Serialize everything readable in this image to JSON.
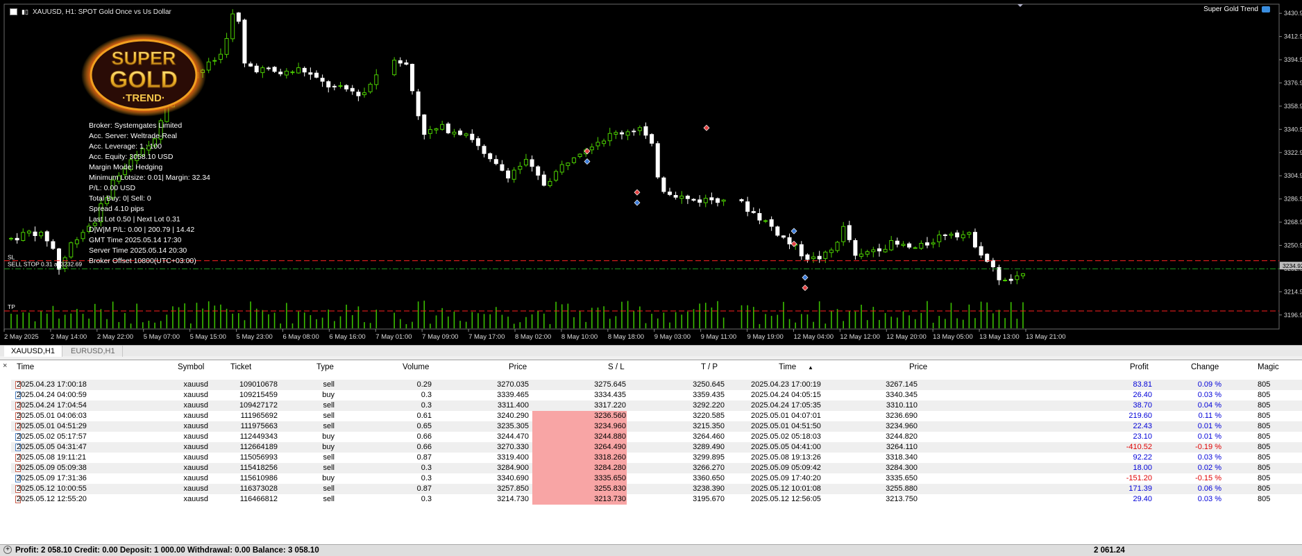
{
  "chart": {
    "title": "XAUUSD, H1:  SPOT Gold Once vs Us Dollar",
    "ea_name": "Super Gold Trend",
    "logo": {
      "line1": "SUPER",
      "line2": "GOLD",
      "line3": "·TREND·"
    },
    "info_lines": [
      "Broker:  Systemgates Limited",
      "Acc. Server:  Weltrade-Real",
      "Acc. Leverage:   1 : 100",
      "Acc. Equity:  3058.10 USD",
      "Margin Mode:  Hedging",
      "Minimum Lotsize: 0.01| Margin: 32.34",
      "P/L: 0.00 USD",
      "Total Buy: 0| Sell: 0",
      "Spread 4.10 pips",
      "Last Lot 0.50 | Next Lot 0.31",
      "D|W|M P/L: 0.00 | 200.79 | 14.42",
      "GMT Time 2025.05.14 17:30",
      "Server Time 2025.05.14 20:30",
      "Broker Offset 10800(UTC+03:00)"
    ],
    "sl_label": "SL",
    "sell_stop_label": "SELL STOP 0.31 at 3232.69",
    "tp_label": "TP",
    "current_price": "3234.92",
    "price_labels": [
      "3430.90",
      "3412.90",
      "3394.90",
      "3376.90",
      "3358.90",
      "3340.90",
      "3322.90",
      "3304.90",
      "3286.90",
      "3268.90",
      "3250.90",
      "3232.90",
      "3214.90",
      "3196.90"
    ],
    "time_labels": [
      "2 May 2025",
      "2 May 14:00",
      "2 May 22:00",
      "5 May 07:00",
      "5 May 15:00",
      "5 May 23:00",
      "6 May 08:00",
      "6 May 16:00",
      "7 May 01:00",
      "7 May 09:00",
      "7 May 17:00",
      "8 May 02:00",
      "8 May 10:00",
      "8 May 18:00",
      "9 May 03:00",
      "9 May 11:00",
      "9 May 19:00",
      "12 May 04:00",
      "12 May 12:00",
      "12 May 20:00",
      "13 May 05:00",
      "13 May 13:00",
      "13 May 21:00"
    ],
    "colors": {
      "background": "#000000",
      "bull_candle": "#4cd000",
      "bear_candle": "#ffffff",
      "volume": "#3bbf00",
      "sl_line": "#ff2020",
      "tp_line": "#ff2020",
      "stop_line": "#20a020"
    },
    "price_range": [
      3186,
      3438
    ]
  },
  "chart_tabs": [
    "XAUUSD,H1",
    "EURUSD,H1"
  ],
  "terminal": {
    "close_icon": "×",
    "columns": [
      "Time",
      "Symbol",
      "Ticket",
      "Type",
      "Volume",
      "Price",
      "S / L",
      "T / P",
      "Time",
      "Price",
      "Profit",
      "Change",
      "Magic"
    ],
    "sort_indicator": "▲",
    "rows": [
      {
        "open_time": "2025.04.23 17:00:18",
        "symbol": "xauusd",
        "ticket": "109010678",
        "type": "sell",
        "volume": "0.29",
        "price": "3270.035",
        "sl": "3275.645",
        "tp": "3250.645",
        "close_time": "2025.04.23 17:00:19",
        "close_price": "3267.145",
        "profit": "83.81",
        "change": "0.09 %",
        "magic": "805",
        "sl_hit": false,
        "loss": false
      },
      {
        "open_time": "2025.04.24 04:00:59",
        "symbol": "xauusd",
        "ticket": "109215459",
        "type": "buy",
        "volume": "0.3",
        "price": "3339.465",
        "sl": "3334.435",
        "tp": "3359.435",
        "close_time": "2025.04.24 04:05:15",
        "close_price": "3340.345",
        "profit": "26.40",
        "change": "0.03 %",
        "magic": "805",
        "sl_hit": false,
        "loss": false
      },
      {
        "open_time": "2025.04.24 17:04:54",
        "symbol": "xauusd",
        "ticket": "109427172",
        "type": "sell",
        "volume": "0.3",
        "price": "3311.400",
        "sl": "3317.220",
        "tp": "3292.220",
        "close_time": "2025.04.24 17:05:35",
        "close_price": "3310.110",
        "profit": "38.70",
        "change": "0.04 %",
        "magic": "805",
        "sl_hit": false,
        "loss": false
      },
      {
        "open_time": "2025.05.01 04:06:03",
        "symbol": "xauusd",
        "ticket": "111965692",
        "type": "sell",
        "volume": "0.61",
        "price": "3240.290",
        "sl": "3236.560",
        "tp": "3220.585",
        "close_time": "2025.05.01 04:07:01",
        "close_price": "3236.690",
        "profit": "219.60",
        "change": "0.11 %",
        "magic": "805",
        "sl_hit": true,
        "loss": false
      },
      {
        "open_time": "2025.05.01 04:51:29",
        "symbol": "xauusd",
        "ticket": "111975663",
        "type": "sell",
        "volume": "0.65",
        "price": "3235.305",
        "sl": "3234.960",
        "tp": "3215.350",
        "close_time": "2025.05.01 04:51:50",
        "close_price": "3234.960",
        "profit": "22.43",
        "change": "0.01 %",
        "magic": "805",
        "sl_hit": true,
        "loss": false
      },
      {
        "open_time": "2025.05.02 05:17:57",
        "symbol": "xauusd",
        "ticket": "112449343",
        "type": "buy",
        "volume": "0.66",
        "price": "3244.470",
        "sl": "3244.880",
        "tp": "3264.460",
        "close_time": "2025.05.02 05:18:03",
        "close_price": "3244.820",
        "profit": "23.10",
        "change": "0.01 %",
        "magic": "805",
        "sl_hit": true,
        "loss": false
      },
      {
        "open_time": "2025.05.05 04:31:47",
        "symbol": "xauusd",
        "ticket": "112664189",
        "type": "buy",
        "volume": "0.66",
        "price": "3270.330",
        "sl": "3264.490",
        "tp": "3289.490",
        "close_time": "2025.05.05 04:41:00",
        "close_price": "3264.110",
        "profit": "-410.52",
        "change": "-0.19 %",
        "magic": "805",
        "sl_hit": true,
        "loss": true
      },
      {
        "open_time": "2025.05.08 19:11:21",
        "symbol": "xauusd",
        "ticket": "115056993",
        "type": "sell",
        "volume": "0.87",
        "price": "3319.400",
        "sl": "3318.260",
        "tp": "3299.895",
        "close_time": "2025.05.08 19:13:26",
        "close_price": "3318.340",
        "profit": "92.22",
        "change": "0.03 %",
        "magic": "805",
        "sl_hit": true,
        "loss": false
      },
      {
        "open_time": "2025.05.09 05:09:38",
        "symbol": "xauusd",
        "ticket": "115418256",
        "type": "sell",
        "volume": "0.3",
        "price": "3284.900",
        "sl": "3284.280",
        "tp": "3266.270",
        "close_time": "2025.05.09 05:09:42",
        "close_price": "3284.300",
        "profit": "18.00",
        "change": "0.02 %",
        "magic": "805",
        "sl_hit": true,
        "loss": false
      },
      {
        "open_time": "2025.05.09 17:31:36",
        "symbol": "xauusd",
        "ticket": "115610986",
        "type": "buy",
        "volume": "0.3",
        "price": "3340.690",
        "sl": "3335.650",
        "tp": "3360.650",
        "close_time": "2025.05.09 17:40:20",
        "close_price": "3335.650",
        "profit": "-151.20",
        "change": "-0.15 %",
        "magic": "805",
        "sl_hit": true,
        "loss": true
      },
      {
        "open_time": "2025.05.12 10:00:55",
        "symbol": "xauusd",
        "ticket": "116373028",
        "type": "sell",
        "volume": "0.87",
        "price": "3257.850",
        "sl": "3255.830",
        "tp": "3238.390",
        "close_time": "2025.05.12 10:01:08",
        "close_price": "3255.880",
        "profit": "171.39",
        "change": "0.06 %",
        "magic": "805",
        "sl_hit": true,
        "loss": false
      },
      {
        "open_time": "2025.05.12 12:55:20",
        "symbol": "xauusd",
        "ticket": "116466812",
        "type": "sell",
        "volume": "0.3",
        "price": "3214.730",
        "sl": "3213.730",
        "tp": "3195.670",
        "close_time": "2025.05.12 12:56:05",
        "close_price": "3213.750",
        "profit": "29.40",
        "change": "0.03 %",
        "magic": "805",
        "sl_hit": true,
        "loss": false
      }
    ],
    "status_text": "Profit: 2 058.10  Credit: 0.00  Deposit: 1 000.00  Withdrawal: 0.00  Balance: 3 058.10",
    "status_total": "2 061.24"
  }
}
